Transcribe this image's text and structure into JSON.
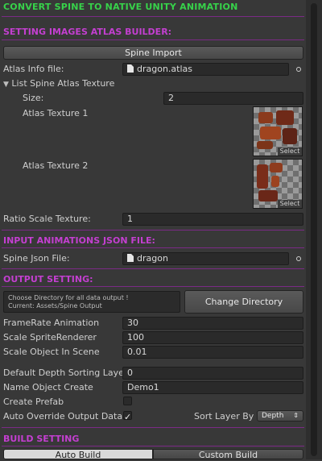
{
  "header": {
    "title": "CONVERT SPINE TO NATIVE UNITY ANIMATION"
  },
  "atlas_section": {
    "title": "SETTING IMAGES ATLAS BUILDER:",
    "spine_import_label": "Spine Import",
    "atlas_info_label": "Atlas Info file:",
    "atlas_info_value": "dragon.atlas",
    "list_label": "List Spine Atlas Texture",
    "size_label": "Size:",
    "size_value": "2",
    "textures": [
      {
        "label": "Atlas Texture 1",
        "select": "Select"
      },
      {
        "label": "Atlas Texture 2",
        "select": "Select"
      }
    ],
    "ratio_label": "Ratio Scale Texture:",
    "ratio_value": "1"
  },
  "json_section": {
    "title": "INPUT ANIMATIONS JSON FILE:",
    "json_label": "Spine Json File:",
    "json_value": "dragon"
  },
  "output_section": {
    "title": "OUTPUT SETTING:",
    "dir_line1": "Choose Directory for all data output !",
    "dir_line2": "Current: Assets/Spine Output",
    "change_dir_label": "Change Directory",
    "framerate_label": "FrameRate Animation",
    "framerate_value": "30",
    "scale_sprite_label": "Scale SpriteRenderer",
    "scale_sprite_value": "100",
    "scale_object_label": "Scale Object In Scene",
    "scale_object_value": "0.01",
    "depth_label": "Default Depth Sorting Layer",
    "depth_value": "0",
    "name_label": "Name Object Create",
    "name_value": "Demo1",
    "prefab_label": "Create Prefab",
    "prefab_checked": false,
    "override_label": "Auto Override Output Data",
    "override_checked": true,
    "override_check_glyph": "✓",
    "sort_label": "Sort Layer By",
    "sort_value": "Depth"
  },
  "build_section": {
    "title": "BUILD SETTING",
    "auto_build": "Auto Build",
    "custom_build": "Custom Build"
  },
  "colors": {
    "section_title": "#c33fd0",
    "header_title": "#37d24a",
    "background": "#383838"
  }
}
